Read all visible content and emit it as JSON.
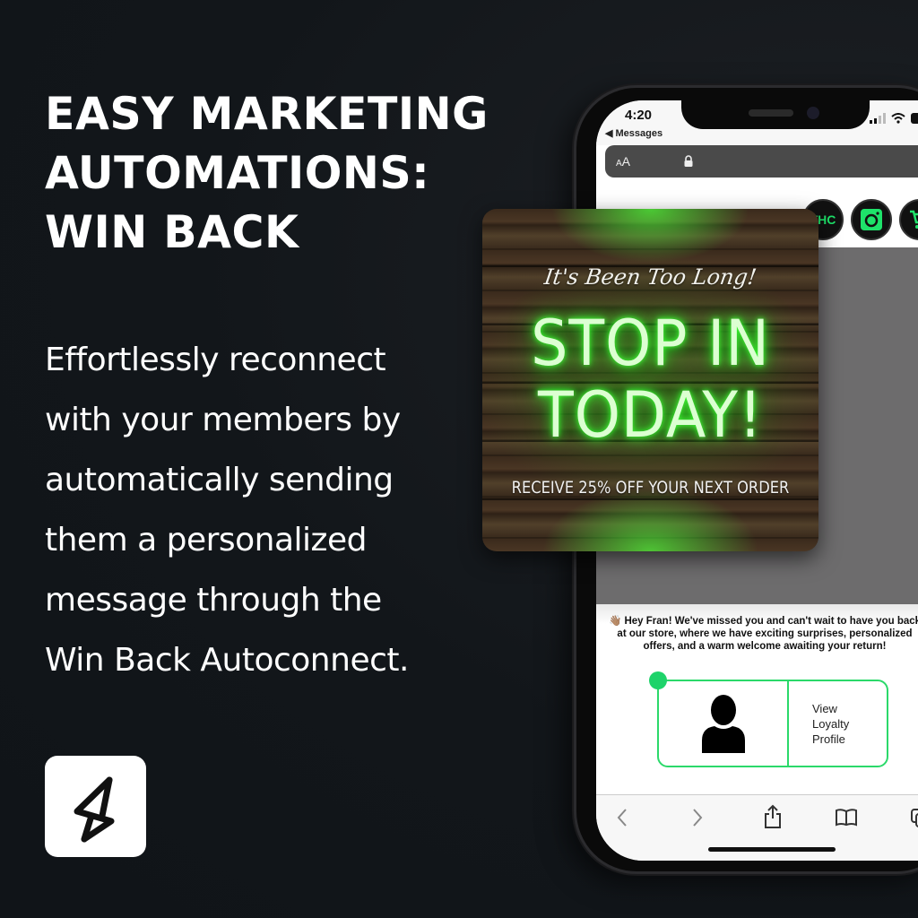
{
  "headline": {
    "lines": [
      "EASY MARKETING",
      "AUTOMATIONS:",
      "WIN BACK"
    ]
  },
  "body_copy": {
    "lines": [
      "Effortlessly reconnect",
      "with your members by",
      "automatically sending",
      "them a personalized",
      "message through the",
      "Win Back Autoconnect."
    ]
  },
  "logo": {
    "icon": "lightning-bolt-icon"
  },
  "phone": {
    "status_bar": {
      "time": "4:20",
      "back_label": "◀ Messages"
    },
    "url_bar": {
      "text_size_label_small": "A",
      "text_size_label_large": "A"
    },
    "social_icons": [
      {
        "name": "thc-logo-icon",
        "label": "THC"
      },
      {
        "name": "instagram-icon",
        "label": ""
      },
      {
        "name": "cart-icon",
        "label": ""
      }
    ],
    "message": {
      "emoji": "👋🏽",
      "text": "Hey Fran! We've missed you and can't wait to have you back at our store, where we have exciting surprises, personalized offers, and a warm welcome awaiting your return!"
    },
    "loyalty": {
      "label_lines": [
        "View",
        "Loyalty",
        "Profile"
      ],
      "accent": "#2bd96a"
    },
    "toolbar": {
      "buttons": [
        "back",
        "forward",
        "share",
        "bookmarks",
        "tabs"
      ]
    }
  },
  "promo": {
    "script_line": "It's Been Too Long!",
    "headline_lines": [
      "STOP IN",
      "TODAY!"
    ],
    "subline": "RECEIVE 25% OFF YOUR NEXT ORDER",
    "glow_color": "#3dff34"
  },
  "colors": {
    "background": "#12161a",
    "accent_green": "#1ee36a"
  }
}
